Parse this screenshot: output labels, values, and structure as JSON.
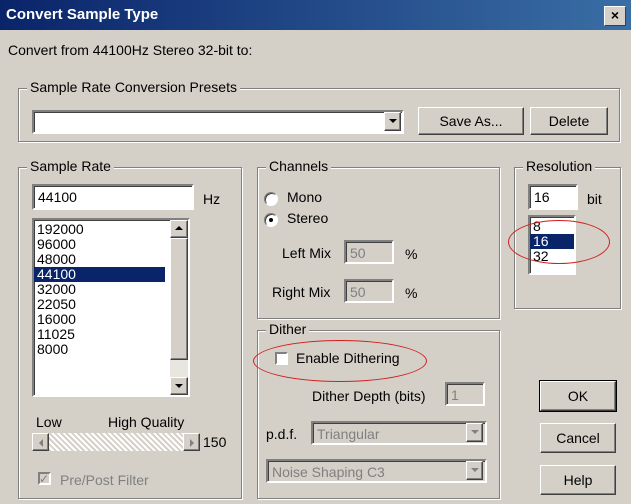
{
  "dialog": {
    "title": "Convert Sample Type",
    "close_label": "×"
  },
  "convert_from": "Convert from 44100Hz Stereo 32-bit to:",
  "presets": {
    "legend": "Sample Rate Conversion Presets",
    "value": "",
    "save_as_label": "Save As...",
    "delete_label": "Delete"
  },
  "sample_rate": {
    "legend": "Sample Rate",
    "value": "44100",
    "unit": "Hz",
    "options": [
      "192000",
      "96000",
      "48000",
      "44100",
      "32000",
      "22050",
      "16000",
      "11025",
      "8000"
    ],
    "selected": "44100",
    "quality_low_label": "Low",
    "quality_high_label": "High Quality",
    "quality_value": "150",
    "pre_post_filter_label": "Pre/Post Filter",
    "pre_post_filter_checked": true
  },
  "channels": {
    "legend": "Channels",
    "mono_label": "Mono",
    "stereo_label": "Stereo",
    "selected": "Stereo",
    "left_mix_label": "Left Mix",
    "left_mix_value": "50",
    "right_mix_label": "Right Mix",
    "right_mix_value": "50",
    "percent": "%"
  },
  "resolution": {
    "legend": "Resolution",
    "value": "16",
    "unit": "bit",
    "options": [
      "8",
      "16",
      "32"
    ],
    "selected": "16"
  },
  "dither": {
    "legend": "Dither",
    "enable_label": "Enable Dithering",
    "enable_checked": false,
    "depth_label": "Dither Depth (bits)",
    "depth_value": "1",
    "pdf_label": "p.d.f.",
    "pdf_value": "Triangular",
    "noise_shaping_value": "Noise Shaping C3"
  },
  "buttons": {
    "ok": "OK",
    "cancel": "Cancel",
    "help": "Help"
  },
  "colors": {
    "titlebar": "#0a246a",
    "highlight": "#0a246a",
    "annotation": "#d02020"
  }
}
